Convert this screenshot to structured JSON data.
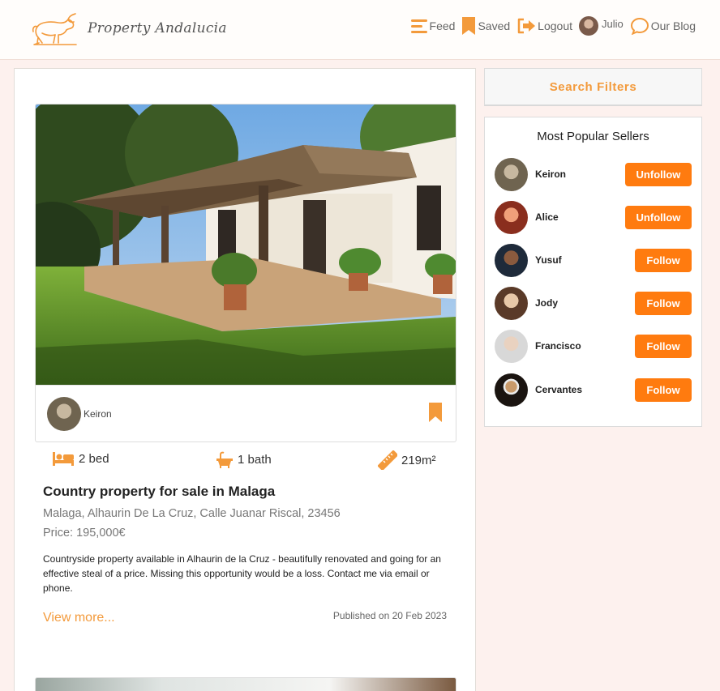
{
  "brand": {
    "name": "Property Andalucia",
    "logo_icon": "bull-icon"
  },
  "nav": {
    "feed": "Feed",
    "saved": "Saved",
    "logout": "Logout",
    "user": "Julio",
    "blog": "Our Blog"
  },
  "post": {
    "seller_name": "Keiron",
    "beds": "2 bed",
    "baths": "1 bath",
    "area": "219m²",
    "title": "Country property for sale in Malaga",
    "address": "Malaga, Alhaurin De La Cruz, Calle Juanar Riscal, 23456",
    "price": "Price: 195,000€",
    "description": "Countryside property available in Alhaurin de la Cruz - beautifully renovated and going for an effective steal of a price. Missing this opportunity would be a loss. Contact me via email or phone.",
    "view_more": "View more...",
    "published": "Published on 20 Feb 2023"
  },
  "sidebar": {
    "filters_label": "Search Filters",
    "popular_title": "Most Popular Sellers",
    "sellers": [
      {
        "name": "Keiron",
        "action": "Unfollow"
      },
      {
        "name": "Alice",
        "action": "Unfollow"
      },
      {
        "name": "Yusuf",
        "action": "Follow"
      },
      {
        "name": "Jody",
        "action": "Follow"
      },
      {
        "name": "Francisco",
        "action": "Follow"
      },
      {
        "name": "Cervantes",
        "action": "Follow"
      }
    ]
  },
  "colors": {
    "accent": "#ff7b0f",
    "accent_text": "#f39a3b",
    "background": "#fdf1ee"
  }
}
